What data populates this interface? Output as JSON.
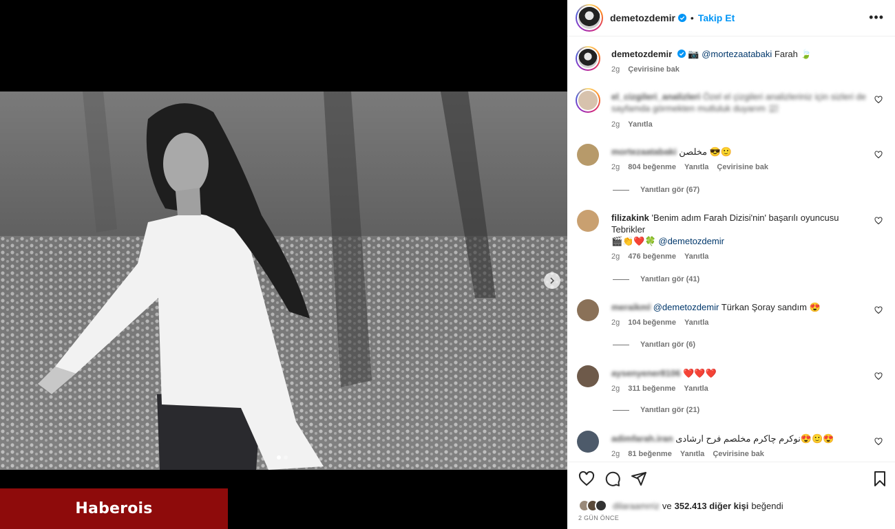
{
  "header": {
    "username": "demetozdemir",
    "follow_label": "Takip Et",
    "more_icon": "more-horizontal-icon"
  },
  "caption": {
    "username": "demetozdemir",
    "mention": "@mortezaatabaki",
    "text": "Farah",
    "emoji_before": "📷",
    "emoji_after": "🍃",
    "time": "2g",
    "translate": "Çevirisine bak"
  },
  "comments": [
    {
      "username": "el_cizgileri_analizleri",
      "text": "Özel el çizgileri analizleriniz için sizleri de sayfamda görmekten mutluluk duyarım 📰",
      "time": "2g",
      "reply": "Yanıtla"
    },
    {
      "username": "mortezaatabaki",
      "text": "مخلصن 😎🙂",
      "time": "2g",
      "likes": "804 beğenme",
      "reply": "Yanıtla",
      "translate": "Çevirisine bak",
      "replies": "Yanıtları gör (67)"
    },
    {
      "username": "filizakink",
      "text": "'Benim adım Farah Dizisi'nin' başarılı oyuncusu Tebrikler",
      "emoji_line": "🎬👏❤️🍀",
      "mention": "@demetozdemir",
      "time": "2g",
      "likes": "476 beğenme",
      "reply": "Yanıtla",
      "replies": "Yanıtları gör (41)"
    },
    {
      "username": "meraikml",
      "mention": "@demetozdemir",
      "text": "Türkan Şoray sandım 😍",
      "time": "2g",
      "likes": "104 beğenme",
      "reply": "Yanıtla",
      "replies": "Yanıtları gör (6)"
    },
    {
      "username": "aysenyener8106",
      "text": "❤️❤️❤️",
      "time": "2g",
      "likes": "311 beğenme",
      "reply": "Yanıtla",
      "replies": "Yanıtları gör (21)"
    },
    {
      "username": "adimfarah.iran",
      "text": "نوکرم چاکرم مخلصم فرح ارشادی😍🙂😍",
      "time": "2g",
      "likes": "81 beğenme",
      "reply": "Yanıtla",
      "translate": "Çevirisine bak"
    }
  ],
  "footer": {
    "liker": "dilaraamrriz",
    "likes_text_pre": "ve",
    "likes_count": "352.413 diğer kişi",
    "likes_text_post": "beğendi",
    "time_ago": "2 GÜN ÖNCE"
  },
  "watermark": "Haberois",
  "colors": {
    "accent": "#0095f6",
    "watermark_bg": "#8e0b0b",
    "muted": "#737373"
  }
}
